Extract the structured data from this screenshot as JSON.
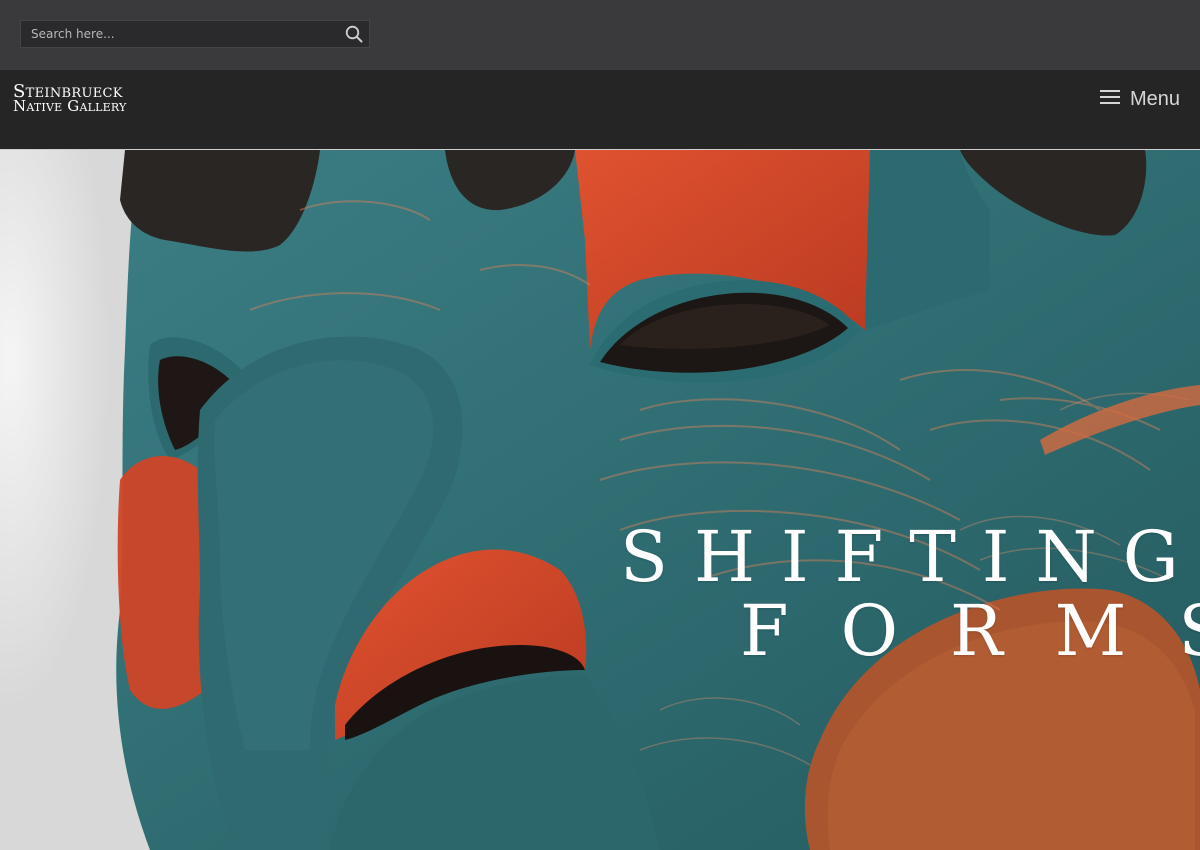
{
  "search": {
    "placeholder": "Search here...",
    "icon": "search-icon"
  },
  "brand": {
    "line1": "Steinbrueck",
    "line2": "Native Gallery"
  },
  "nav": {
    "menu_label": "Menu",
    "menu_icon": "hamburger-icon"
  },
  "hero": {
    "title_line1": "SHIFTING",
    "title_line2": "FORMS",
    "image_subject": "carved wooden mask painted teal, red and black"
  },
  "colors": {
    "top_bar": "#3a393b",
    "nav_bar": "#252525",
    "mask_teal": "#2f6f74",
    "mask_red": "#d6472a",
    "mask_black": "#2a2624"
  }
}
